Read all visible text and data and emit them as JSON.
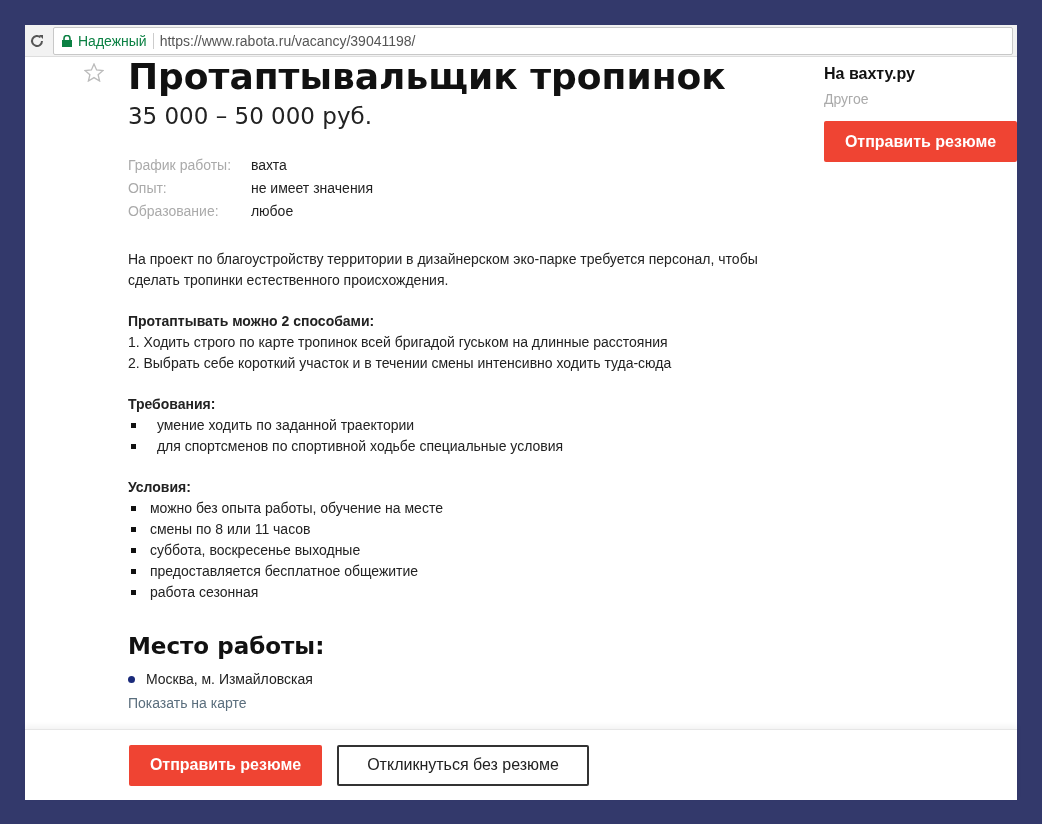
{
  "address_bar": {
    "security": "Надежный",
    "url": "https://www.rabota.ru/vacancy/39041198/"
  },
  "vacancy": {
    "title": "Протаптывальщик тропинок",
    "salary": "35 000 – 50 000 руб.",
    "details": [
      {
        "label": "График работы:",
        "value": "вахта"
      },
      {
        "label": "Опыт:",
        "value": "не имеет значения"
      },
      {
        "label": "Образование:",
        "value": "любое"
      }
    ],
    "description": "На проект по благоустройству территории в дизайнерском эко-парке требуется персонал, чтобы сделать тропинки естественного происхождения.",
    "sections": [
      {
        "heading": "Протаптывать можно 2 способами:",
        "kind": "plain",
        "items": [
          "1. Ходить строго по карте тропинок всей бригадой гуськом на длинные расстояния",
          "2. Выбрать себе короткий участок и в течении смены интенсивно ходить туда-сюда"
        ]
      },
      {
        "heading": "Требования:",
        "kind": "bullets-wide",
        "items": [
          "умение ходить по заданной траектории",
          "для спортсменов по спортивной ходьбе специальные условия"
        ]
      },
      {
        "heading": "Условия:",
        "kind": "bullets",
        "items": [
          "можно без опыта работы, обучение на месте",
          "смены по 8 или 11 часов",
          "суббота, воскресенье выходные",
          "предоставляется бесплатное общежитие",
          "работа сезонная"
        ]
      }
    ],
    "workplace": {
      "heading": "Место работы:",
      "location": "Москва, м. Измайловская",
      "map_link": "Показать на карте"
    }
  },
  "employer": {
    "name": "На вахту.ру",
    "category": "Другое",
    "button": "Отправить резюме"
  },
  "bottom_bar": {
    "primary_button": "Отправить резюме",
    "secondary_button": "Откликнуться без резюме"
  }
}
